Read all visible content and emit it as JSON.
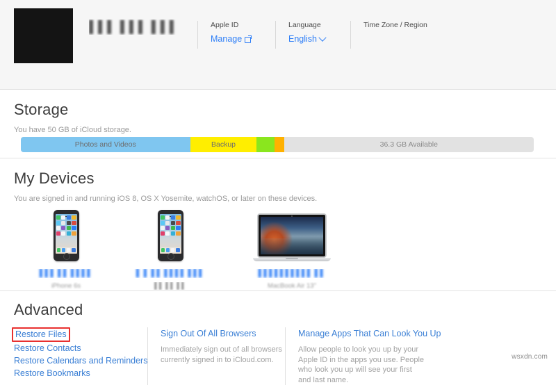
{
  "header": {
    "avatar_label": "account-photo",
    "account_name_redacted": "▌▌▌  ▌▌▌ ▌▌▌  ▌▌",
    "columns": [
      {
        "label": "Apple ID",
        "value": "Manage",
        "icon": "external-link-icon",
        "has_chevron": false
      },
      {
        "label": "Language",
        "value": "English",
        "icon": "",
        "has_chevron": true
      },
      {
        "label": "Time Zone / Region",
        "value": "",
        "icon": "",
        "has_chevron": false
      }
    ]
  },
  "storage": {
    "title": "Storage",
    "subtitle": "You have 50 GB of iCloud storage.",
    "segments": [
      {
        "label": "Photos and Videos",
        "color": "#7fc6f0",
        "width_pct": 33.0
      },
      {
        "label": "Backup",
        "color": "#ffee00",
        "width_pct": 13.0
      },
      {
        "label": "",
        "color": "#8ae61e",
        "width_pct": 3.4
      },
      {
        "label": "",
        "color": "#ffb100",
        "width_pct": 1.9
      }
    ],
    "available_label": "36.3 GB Available",
    "track_color": "#e2e2e2"
  },
  "devices": {
    "title": "My Devices",
    "subtitle": "You are signed in and running iOS 8, OS X Yosemite, watchOS, or later on these devices.",
    "items": [
      {
        "art": "iphone",
        "name_redacted": "▌▌▌ ▌▌ ▌▌▌▌",
        "model_redacted": "iPhone 6s"
      },
      {
        "art": "iphone",
        "name_redacted": "▌ ▌ ▌▌ ▌▌▌▌ ▌▌▌",
        "model_redacted": "▌▌ ▌▌ ▌▌"
      },
      {
        "art": "macbook",
        "name_redacted": "▌▌▌▌▌▌▌▌▌▌ ▌▌",
        "model_redacted": "MacBook Air 13\""
      }
    ]
  },
  "advanced": {
    "title": "Advanced",
    "columns": [
      {
        "links": [
          {
            "label": "Restore Files",
            "highlighted": true
          },
          {
            "label": "Restore Contacts",
            "highlighted": false
          },
          {
            "label": "Restore Calendars and Reminders",
            "highlighted": false
          },
          {
            "label": "Restore Bookmarks",
            "highlighted": false
          }
        ],
        "description": ""
      },
      {
        "links": [
          {
            "label": "Sign Out Of All Browsers",
            "highlighted": false
          }
        ],
        "description": "Immediately sign out of all browsers currently signed in to iCloud.com."
      },
      {
        "links": [
          {
            "label": "Manage Apps That Can Look You Up",
            "highlighted": false
          }
        ],
        "description": "Allow people to look you up by your Apple ID in the apps you use. People who look you up will see your first and last name."
      }
    ]
  },
  "watermark": "wsxdn.com",
  "colors": {
    "link_blue": "#2d7ef7",
    "highlight_red": "#e8302f",
    "header_bg": "#f6f6f6"
  }
}
